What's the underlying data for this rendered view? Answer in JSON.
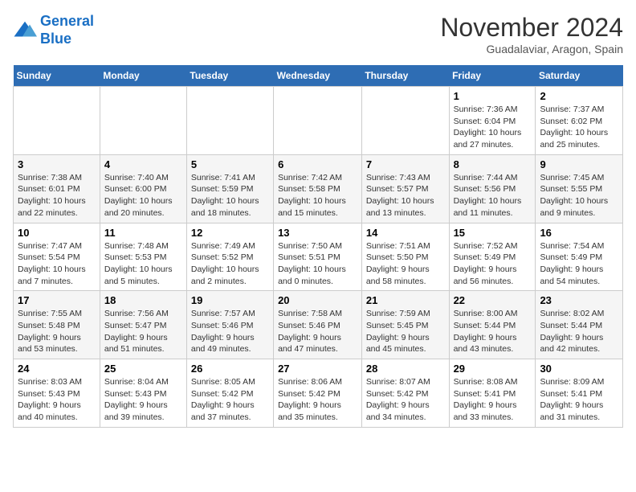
{
  "header": {
    "logo_line1": "General",
    "logo_line2": "Blue",
    "month": "November 2024",
    "location": "Guadalaviar, Aragon, Spain"
  },
  "weekdays": [
    "Sunday",
    "Monday",
    "Tuesday",
    "Wednesday",
    "Thursday",
    "Friday",
    "Saturday"
  ],
  "weeks": [
    [
      {
        "day": "",
        "info": ""
      },
      {
        "day": "",
        "info": ""
      },
      {
        "day": "",
        "info": ""
      },
      {
        "day": "",
        "info": ""
      },
      {
        "day": "",
        "info": ""
      },
      {
        "day": "1",
        "info": "Sunrise: 7:36 AM\nSunset: 6:04 PM\nDaylight: 10 hours and 27 minutes."
      },
      {
        "day": "2",
        "info": "Sunrise: 7:37 AM\nSunset: 6:02 PM\nDaylight: 10 hours and 25 minutes."
      }
    ],
    [
      {
        "day": "3",
        "info": "Sunrise: 7:38 AM\nSunset: 6:01 PM\nDaylight: 10 hours and 22 minutes."
      },
      {
        "day": "4",
        "info": "Sunrise: 7:40 AM\nSunset: 6:00 PM\nDaylight: 10 hours and 20 minutes."
      },
      {
        "day": "5",
        "info": "Sunrise: 7:41 AM\nSunset: 5:59 PM\nDaylight: 10 hours and 18 minutes."
      },
      {
        "day": "6",
        "info": "Sunrise: 7:42 AM\nSunset: 5:58 PM\nDaylight: 10 hours and 15 minutes."
      },
      {
        "day": "7",
        "info": "Sunrise: 7:43 AM\nSunset: 5:57 PM\nDaylight: 10 hours and 13 minutes."
      },
      {
        "day": "8",
        "info": "Sunrise: 7:44 AM\nSunset: 5:56 PM\nDaylight: 10 hours and 11 minutes."
      },
      {
        "day": "9",
        "info": "Sunrise: 7:45 AM\nSunset: 5:55 PM\nDaylight: 10 hours and 9 minutes."
      }
    ],
    [
      {
        "day": "10",
        "info": "Sunrise: 7:47 AM\nSunset: 5:54 PM\nDaylight: 10 hours and 7 minutes."
      },
      {
        "day": "11",
        "info": "Sunrise: 7:48 AM\nSunset: 5:53 PM\nDaylight: 10 hours and 5 minutes."
      },
      {
        "day": "12",
        "info": "Sunrise: 7:49 AM\nSunset: 5:52 PM\nDaylight: 10 hours and 2 minutes."
      },
      {
        "day": "13",
        "info": "Sunrise: 7:50 AM\nSunset: 5:51 PM\nDaylight: 10 hours and 0 minutes."
      },
      {
        "day": "14",
        "info": "Sunrise: 7:51 AM\nSunset: 5:50 PM\nDaylight: 9 hours and 58 minutes."
      },
      {
        "day": "15",
        "info": "Sunrise: 7:52 AM\nSunset: 5:49 PM\nDaylight: 9 hours and 56 minutes."
      },
      {
        "day": "16",
        "info": "Sunrise: 7:54 AM\nSunset: 5:49 PM\nDaylight: 9 hours and 54 minutes."
      }
    ],
    [
      {
        "day": "17",
        "info": "Sunrise: 7:55 AM\nSunset: 5:48 PM\nDaylight: 9 hours and 53 minutes."
      },
      {
        "day": "18",
        "info": "Sunrise: 7:56 AM\nSunset: 5:47 PM\nDaylight: 9 hours and 51 minutes."
      },
      {
        "day": "19",
        "info": "Sunrise: 7:57 AM\nSunset: 5:46 PM\nDaylight: 9 hours and 49 minutes."
      },
      {
        "day": "20",
        "info": "Sunrise: 7:58 AM\nSunset: 5:46 PM\nDaylight: 9 hours and 47 minutes."
      },
      {
        "day": "21",
        "info": "Sunrise: 7:59 AM\nSunset: 5:45 PM\nDaylight: 9 hours and 45 minutes."
      },
      {
        "day": "22",
        "info": "Sunrise: 8:00 AM\nSunset: 5:44 PM\nDaylight: 9 hours and 43 minutes."
      },
      {
        "day": "23",
        "info": "Sunrise: 8:02 AM\nSunset: 5:44 PM\nDaylight: 9 hours and 42 minutes."
      }
    ],
    [
      {
        "day": "24",
        "info": "Sunrise: 8:03 AM\nSunset: 5:43 PM\nDaylight: 9 hours and 40 minutes."
      },
      {
        "day": "25",
        "info": "Sunrise: 8:04 AM\nSunset: 5:43 PM\nDaylight: 9 hours and 39 minutes."
      },
      {
        "day": "26",
        "info": "Sunrise: 8:05 AM\nSunset: 5:42 PM\nDaylight: 9 hours and 37 minutes."
      },
      {
        "day": "27",
        "info": "Sunrise: 8:06 AM\nSunset: 5:42 PM\nDaylight: 9 hours and 35 minutes."
      },
      {
        "day": "28",
        "info": "Sunrise: 8:07 AM\nSunset: 5:42 PM\nDaylight: 9 hours and 34 minutes."
      },
      {
        "day": "29",
        "info": "Sunrise: 8:08 AM\nSunset: 5:41 PM\nDaylight: 9 hours and 33 minutes."
      },
      {
        "day": "30",
        "info": "Sunrise: 8:09 AM\nSunset: 5:41 PM\nDaylight: 9 hours and 31 minutes."
      }
    ]
  ]
}
